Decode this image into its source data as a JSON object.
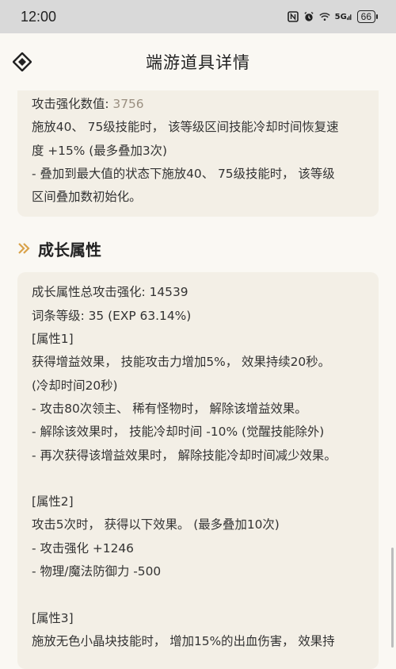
{
  "status_bar": {
    "time": "12:00",
    "icons": [
      "nfc-icon",
      "alarm-icon",
      "wifi-icon",
      "signal-5g-icon"
    ],
    "signal_label": "5G",
    "battery": "66"
  },
  "header": {
    "title": "端游道具详情"
  },
  "top_card": {
    "lines": [
      {
        "label": "攻击强化数值: ",
        "value": "3756"
      },
      {
        "text": "施放40、 75级技能时， 该等级区间技能冷却时间恢复速"
      },
      {
        "text": "度 +15% (最多叠加3次)"
      },
      {
        "text": "- 叠加到最大值的状态下施放40、 75级技能时， 该等级"
      },
      {
        "text": "区间叠加数初始化。"
      }
    ]
  },
  "growth_section": {
    "title": "成长属性",
    "lines": [
      "成长属性总攻击强化: 14539",
      "词条等级: 35 (EXP 63.14%)",
      "[属性1]",
      "获得增益效果， 技能攻击力增加5%， 效果持续20秒。",
      "(冷却时间20秒)",
      "- 攻击80次领主、 稀有怪物时， 解除该增益效果。",
      "- 解除该效果时， 技能冷却时间 -10% (觉醒技能除外)",
      "- 再次获得该增益效果时， 解除技能冷却时间减少效果。",
      "",
      "[属性2]",
      "攻击5次时， 获得以下效果。 (最多叠加10次)",
      "- 攻击强化 +1246",
      "- 物理/魔法防御力 -500",
      "",
      "[属性3]",
      "施放无色小晶块技能时， 增加15%的出血伤害， 效果持"
    ]
  },
  "colors": {
    "accent": "#d9a24a",
    "card_bg": "#f3efe6",
    "page_bg": "#faf8f3",
    "muted_value": "#9a8f80"
  }
}
